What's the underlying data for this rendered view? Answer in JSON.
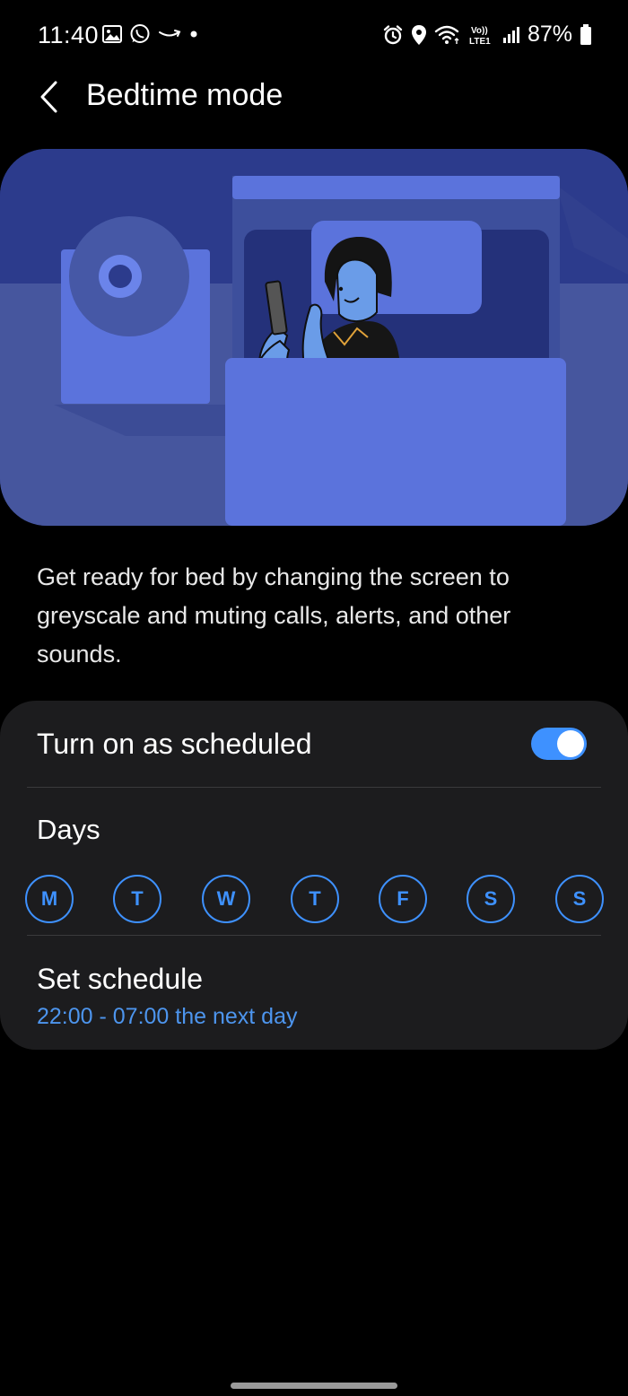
{
  "status_bar": {
    "time": "11:40",
    "battery": "87%",
    "network_badge": "Vo)) LTE1",
    "left_icons": [
      "gallery-icon",
      "whatsapp-icon",
      "amazon-icon",
      "dot-icon"
    ],
    "right_icons": [
      "alarm-icon",
      "location-icon",
      "wifi-icon",
      "lte-icon",
      "signal-icon",
      "battery-icon"
    ]
  },
  "header": {
    "title": "Bedtime mode"
  },
  "description": "Get ready for bed by changing the screen to greyscale and muting calls, alerts, and other sounds.",
  "settings": {
    "schedule_toggle_label": "Turn on as scheduled",
    "schedule_toggle_on": true,
    "days_label": "Days",
    "days": [
      "M",
      "T",
      "W",
      "T",
      "F",
      "S",
      "S"
    ],
    "set_schedule_label": "Set schedule",
    "schedule_value": "22:00 - 07:00 the next day"
  },
  "colors": {
    "accent": "#3e91ff",
    "background": "#000000",
    "card": "#1c1c1e",
    "illustration_bg": "#2c3b8c"
  }
}
